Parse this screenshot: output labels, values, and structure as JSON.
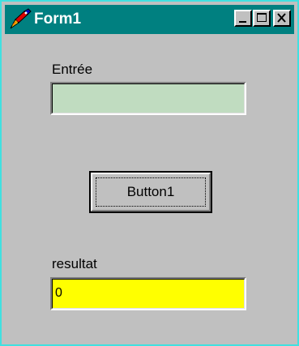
{
  "window": {
    "title": "Form1",
    "title_bar_color": "#008080",
    "frame_color": "#c0c0c0",
    "controls": [
      "minimize-icon",
      "maximize-icon",
      "close-icon"
    ]
  },
  "form": {
    "entree_label": "Entrée",
    "entree_value": "",
    "entree_background": "#c0dcc0",
    "button_label": "Button1",
    "resultat_label": "resultat",
    "resultat_value": "0",
    "resultat_background": "#ffff00"
  }
}
